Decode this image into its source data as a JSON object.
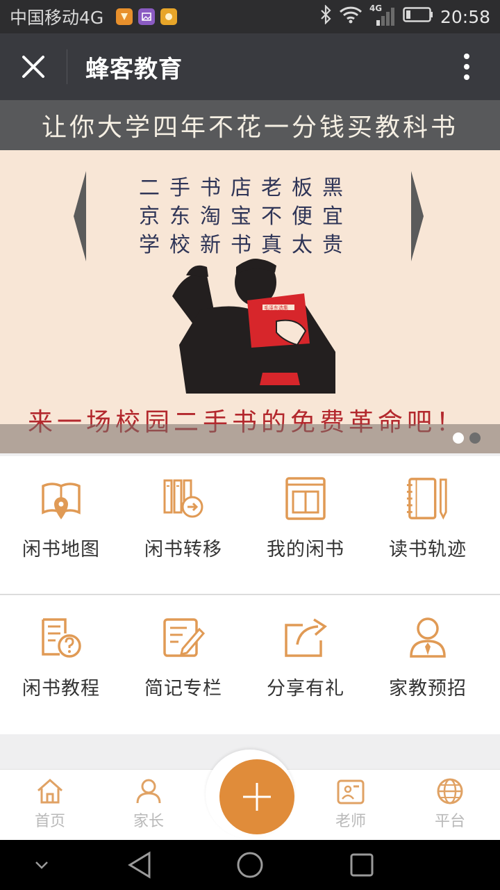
{
  "status_bar": {
    "carrier": "中国移动4G",
    "network_badge": "4G",
    "time": "20:58"
  },
  "title_bar": {
    "title": "蜂客教育"
  },
  "banner": {
    "headline": "让你大学四年不花一分钱买教科书",
    "poem": [
      "二手书店老板黑",
      "京东淘宝不便宜",
      "学校新书真太贵"
    ],
    "book_title": "毛泽东选集",
    "slogan": "来一场校园二手书的免费革命吧！",
    "active_slide": 1,
    "slide_count": 2
  },
  "grid": {
    "row1": [
      {
        "label": "闲书地图",
        "icon": "book-map-icon"
      },
      {
        "label": "闲书转移",
        "icon": "book-transfer-icon"
      },
      {
        "label": "我的闲书",
        "icon": "my-books-icon"
      },
      {
        "label": "读书轨迹",
        "icon": "reading-track-icon"
      }
    ],
    "row2": [
      {
        "label": "闲书教程",
        "icon": "tutorial-icon"
      },
      {
        "label": "简记专栏",
        "icon": "notes-column-icon"
      },
      {
        "label": "分享有礼",
        "icon": "share-gift-icon"
      },
      {
        "label": "家教预招",
        "icon": "tutor-recruit-icon"
      }
    ]
  },
  "bottom_nav": {
    "items": [
      {
        "label": "首页",
        "icon": "home-icon"
      },
      {
        "label": "家长",
        "icon": "parent-icon"
      },
      {
        "label": "老师",
        "icon": "teacher-icon"
      },
      {
        "label": "平台",
        "icon": "globe-icon"
      }
    ],
    "fab_icon": "plus-icon"
  },
  "colors": {
    "accent": "#e08c3a",
    "icon_orange": "#e09a55",
    "titlebar": "#393a3f",
    "statusbar": "#2d2d2f",
    "nav_inactive": "#b9b9b9"
  }
}
